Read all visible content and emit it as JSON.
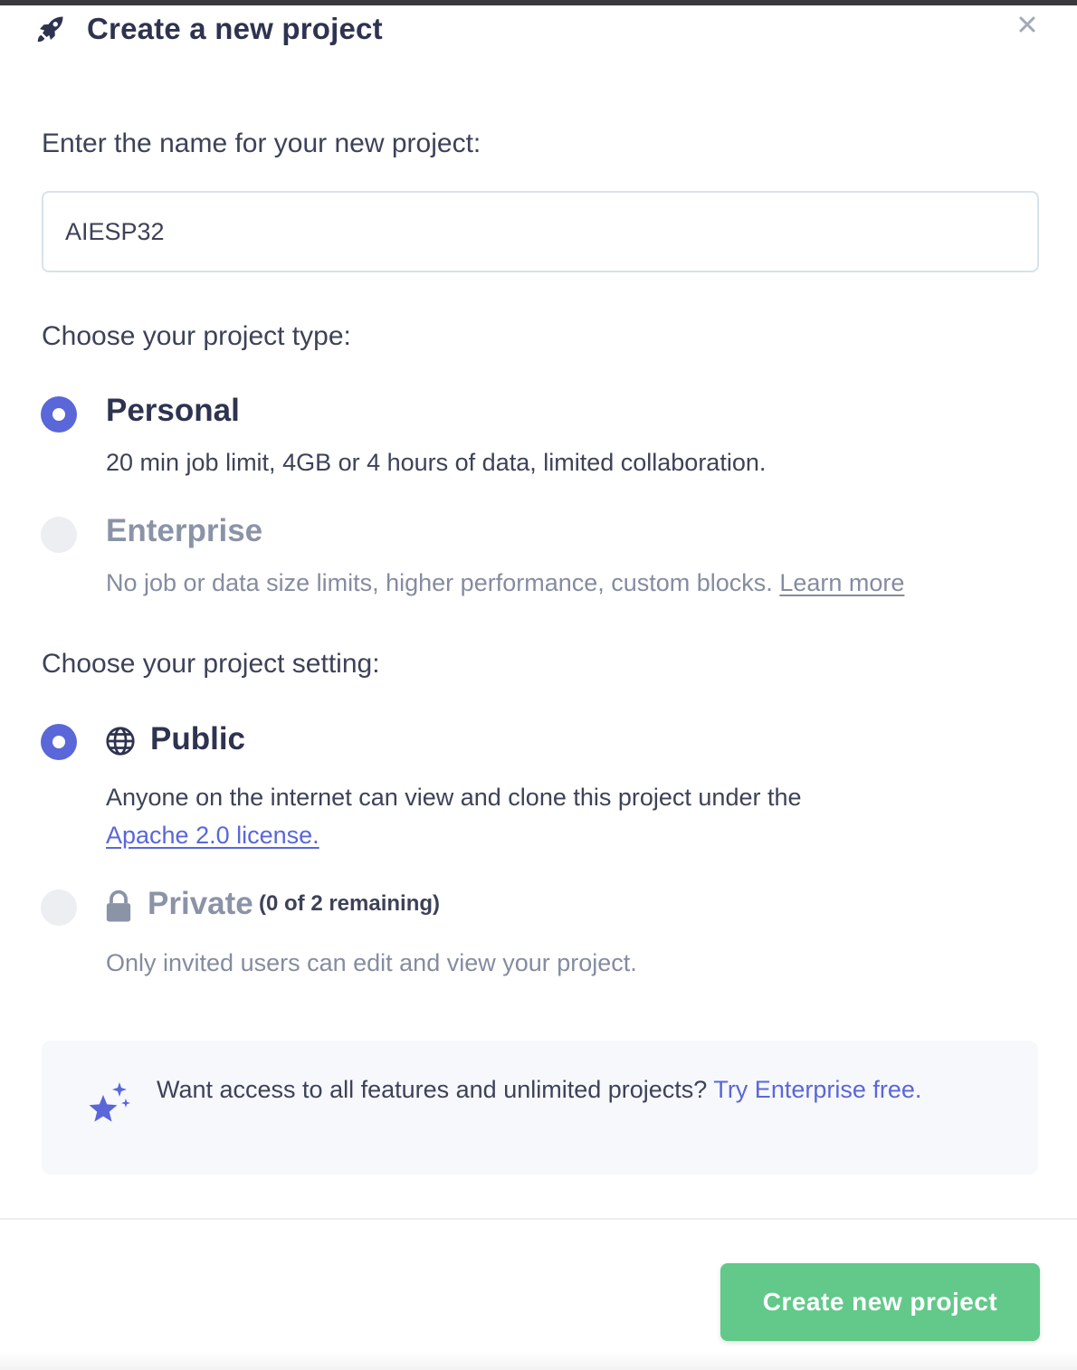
{
  "modal": {
    "title": "Create a new project",
    "header_icon": "rocket-icon",
    "close_icon": "close-icon"
  },
  "name_section": {
    "label": "Enter the name for your new project:",
    "input_value": "AIESP32"
  },
  "type_section": {
    "label": "Choose your project type:",
    "options": [
      {
        "title": "Personal",
        "description": "20 min job limit, 4GB or 4 hours of data, limited collaboration.",
        "selected": true
      },
      {
        "title": "Enterprise",
        "description": "No job or data size limits, higher performance, custom blocks.",
        "link": "Learn more",
        "selected": false
      }
    ]
  },
  "setting_section": {
    "label": "Choose your project setting:",
    "options": [
      {
        "icon": "globe-icon",
        "title": "Public",
        "description": "Anyone on the internet can view and clone this project under the",
        "link": "Apache 2.0 license.",
        "selected": true
      },
      {
        "icon": "lock-icon",
        "title": "Private",
        "remaining": "(0 of 2 remaining)",
        "description": "Only invited users can edit and view your project.",
        "selected": false
      }
    ]
  },
  "promo": {
    "icon": "sparkle-star-icon",
    "text": "Want access to all features and unlimited projects?",
    "cta": "Try Enterprise free."
  },
  "footer": {
    "create_button": "Create new project"
  },
  "colors": {
    "accent": "#5a67d8",
    "button": "#62c98a",
    "text": "#2e3350",
    "muted": "#858ca0"
  }
}
